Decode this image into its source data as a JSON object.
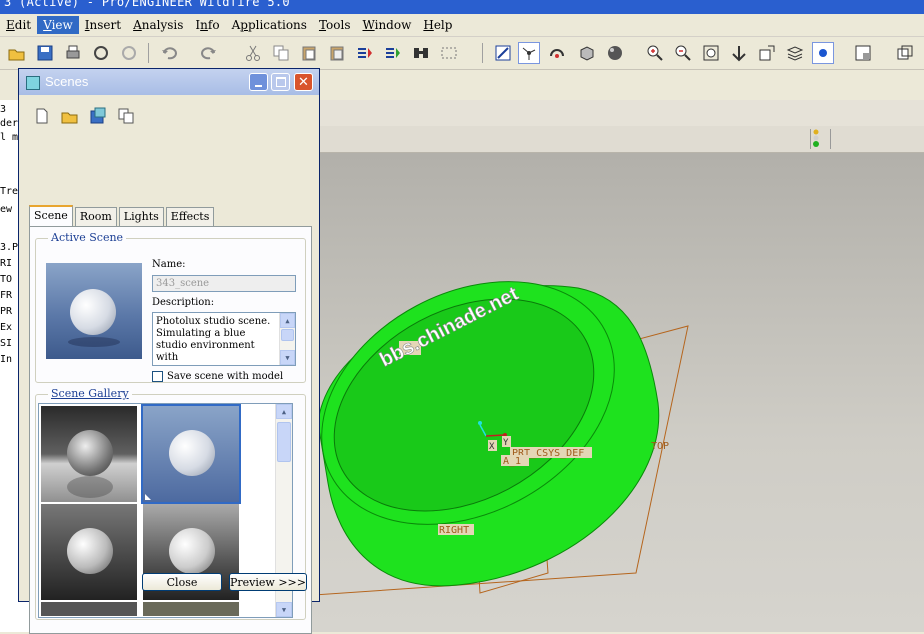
{
  "window": {
    "title": "3 (Active) - Pro/ENGINEER Wildfire 5.0"
  },
  "menu": [
    {
      "pre": "",
      "ul": "E",
      "post": "dit"
    },
    {
      "pre": "",
      "ul": "V",
      "post": "iew",
      "active": true
    },
    {
      "pre": "",
      "ul": "I",
      "post": "nsert"
    },
    {
      "pre": "",
      "ul": "A",
      "post": "nalysis"
    },
    {
      "pre": "I",
      "ul": "n",
      "post": "fo"
    },
    {
      "pre": "A",
      "ul": "p",
      "post": "plications"
    },
    {
      "pre": "",
      "ul": "T",
      "post": "ools"
    },
    {
      "pre": "",
      "ul": "W",
      "post": "indow"
    },
    {
      "pre": "",
      "ul": "H",
      "post": "elp"
    }
  ],
  "tree": {
    "lines": [
      "3",
      "der",
      "l m",
      "Tre",
      "ew",
      "3.P",
      "RI",
      "TO",
      "FR",
      "PR",
      "Ex",
      "SI",
      "In"
    ]
  },
  "dialog": {
    "title": "Scenes",
    "tabs": [
      "Scene",
      "Room",
      "Lights",
      "Effects"
    ],
    "active_scene_label": "Active Scene",
    "name_label": "Name:",
    "name_value": "343_scene",
    "description_label": "Description:",
    "description": "Photolux studio scene. Simulating a blue studio environment with",
    "save_with_model_label": "Save scene with model",
    "save_with_model_checked": false,
    "gallery_label": "Scene Gallery",
    "close_label": "Close",
    "preview_label": "Preview >>>"
  },
  "viewport": {
    "labels": {
      "csys": "PRT_CSYS_DEF",
      "top": "TOP",
      "right": "RIGHT",
      "a1": "A_1",
      "x": "X",
      "y": "Y"
    },
    "watermark": "bbs.chinade.net",
    "model_color": "#1ee21e",
    "datum_color": "#b5651d"
  }
}
